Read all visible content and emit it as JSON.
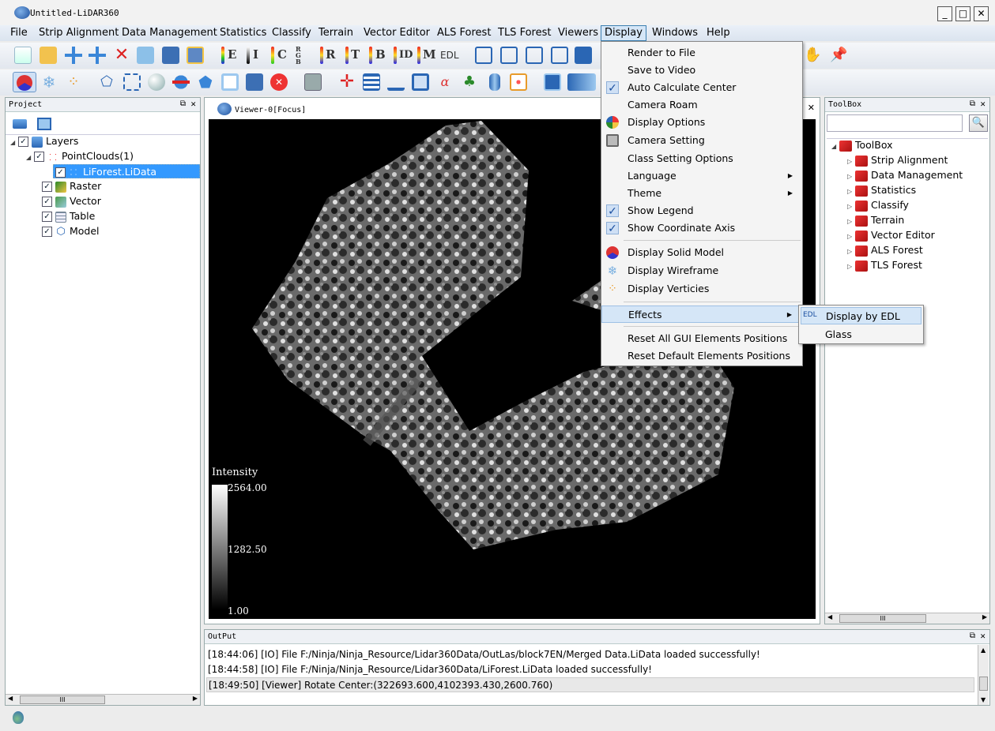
{
  "window": {
    "title": "Untitled-LiDAR360",
    "minimize": "_",
    "maximize": "□",
    "close": "✕"
  },
  "menubar": {
    "items": [
      "File",
      "Strip Alignment",
      "Data Management",
      "Statistics",
      "Classify",
      "Terrain",
      "Vector Editor",
      "ALS Forest",
      "TLS Forest",
      "Viewers",
      "Display",
      "Windows",
      "Help"
    ],
    "active": "Display"
  },
  "toolbar1": {
    "letters": [
      "E",
      "I",
      "C",
      "RGB",
      "R",
      "T",
      "B",
      "ID",
      "M",
      "EDL"
    ]
  },
  "project": {
    "title": "Project",
    "tree": [
      {
        "label": "Layers",
        "level": 0
      },
      {
        "label": "PointClouds(1)",
        "level": 1
      },
      {
        "label": "LiForest.LiData",
        "level": 2
      },
      {
        "label": "Raster",
        "level": 1
      },
      {
        "label": "Vector",
        "level": 1
      },
      {
        "label": "Table",
        "level": 1
      },
      {
        "label": "Model",
        "level": 1
      }
    ],
    "scroll_grip": "III"
  },
  "viewer": {
    "title": "Viewer-0[Focus]",
    "legend": {
      "title": "Intensity",
      "max": "2564.00",
      "mid": "1282.50",
      "min": "1.00"
    }
  },
  "display_menu": {
    "items": [
      {
        "label": "Render to File"
      },
      {
        "label": "Save to Video"
      },
      {
        "label": "Auto Calculate Center",
        "checked": true
      },
      {
        "label": "Camera Roam"
      },
      {
        "label": "Display Options",
        "icon": "palette-icon"
      },
      {
        "label": "Camera Setting",
        "icon": "camera-icon"
      },
      {
        "label": "Class Setting Options"
      },
      {
        "label": "Language",
        "submenu": true
      },
      {
        "label": "Theme",
        "submenu": true
      },
      {
        "label": "Show Legend",
        "checked": true
      },
      {
        "label": "Show Coordinate Axis",
        "checked": true
      },
      {
        "label": "Display Solid Model",
        "icon": "solid-model-icon"
      },
      {
        "label": "Display Wireframe",
        "icon": "wireframe-icon"
      },
      {
        "label": "Display Verticies",
        "icon": "vertices-icon"
      },
      {
        "label": "Effects",
        "submenu": true,
        "highlighted": true
      },
      {
        "label": "Reset All GUI Elements Positions"
      },
      {
        "label": "Reset Default Elements Positions"
      }
    ],
    "check_glyph": "✓",
    "arrow_glyph": "▶"
  },
  "effects_submenu": {
    "items": [
      {
        "label": "Display by EDL",
        "icon_text": "EDL",
        "highlighted": true
      },
      {
        "label": "Glass"
      }
    ]
  },
  "toolbox": {
    "title": "ToolBox",
    "search_value": "",
    "search_icon": "magnifier-icon",
    "root": "ToolBox",
    "items": [
      "Strip Alignment",
      "Data Management",
      "Statistics",
      "Classify",
      "Terrain",
      "Vector Editor",
      "ALS Forest",
      "TLS Forest"
    ],
    "scroll_grip": "III"
  },
  "output": {
    "title": "OutPut",
    "lines": [
      "[18:44:06] [IO]     File F:/Ninja/Ninja_Resource/Lidar360Data/OutLas/block7EN/Merged Data.LiData loaded successfully!",
      "[18:44:58] [IO]     File F:/Ninja/Ninja_Resource/Lidar360Data/LiForest.LiData loaded successfully!",
      "[18:49:50] [Viewer]    Rotate Center:(322693.600,4102393.430,2600.760)"
    ]
  },
  "colors": {
    "menu_highlight": "#d5e6f7",
    "selection": "#3399ff",
    "viewer_bg": "#000000"
  }
}
